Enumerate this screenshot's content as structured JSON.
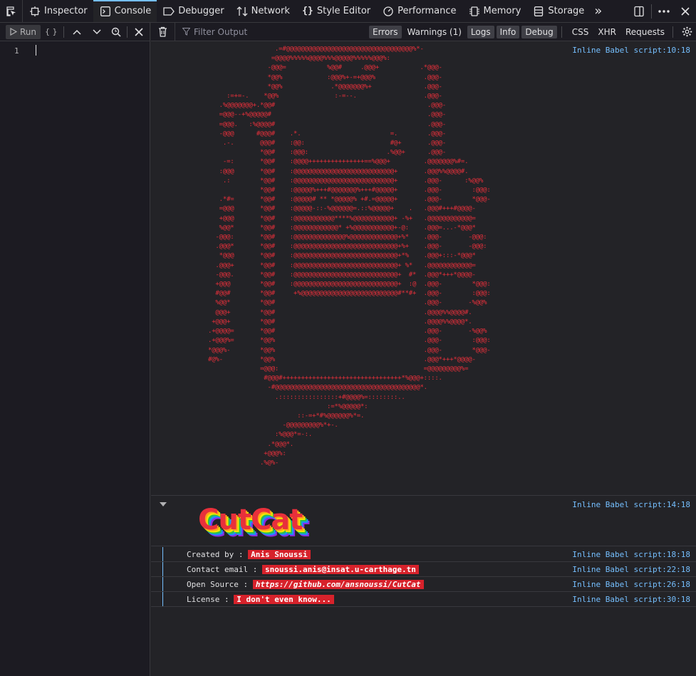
{
  "toolbar": {
    "tabs": [
      {
        "label": "Inspector",
        "icon": "inspector-icon"
      },
      {
        "label": "Console",
        "icon": "console-icon",
        "active": true
      },
      {
        "label": "Debugger",
        "icon": "debugger-icon"
      },
      {
        "label": "Network",
        "icon": "network-icon"
      },
      {
        "label": "Style Editor",
        "icon": "style-editor-icon"
      },
      {
        "label": "Performance",
        "icon": "performance-icon"
      },
      {
        "label": "Memory",
        "icon": "memory-icon"
      },
      {
        "label": "Storage",
        "icon": "storage-icon"
      }
    ],
    "overflow_label": "»"
  },
  "editor": {
    "run_label": "Run",
    "pretty_label": "{ }",
    "line_number": "1"
  },
  "filter": {
    "placeholder": "Filter Output",
    "buttons": {
      "errors": "Errors",
      "warnings": "Warnings (1)",
      "logs": "Logs",
      "info": "Info",
      "debug": "Debug",
      "css": "CSS",
      "xhr": "XHR",
      "requests": "Requests"
    }
  },
  "messages": {
    "art_location": "Inline Babel script:10:18",
    "ascii_art": "                  .=#@@@@@@@@@@@@@@@@@@@@@@@@@@@@@@@@@@%*-\n                 =@@@@%%%%%@@@@%%%@@@@@%%%%%@@@%:\n                -@@@=           %@@#     .@@@+           .*@@@-\n                *@@%            :@@@%+-=+@@@%             .@@@-\n                *@@%             .*@@@@@@@%+              .@@@-\n     :=+=-.    *@@%               :-=--.                  .@@@-\n   .%@@@@@@@+.*@@#                                         .@@@-\n   =@@@--+%@@@@@#                                          .@@@-\n   =@@@.   :%@@@@#                                         .@@@-\n   -@@@      #@@@#    .*.                        =.        .@@@-\n    .-.       @@@#    :@@:                       #@+       .@@@-\n              *@@#    :@@@:                     .%@@+      .@@@-\n    -=:       *@@#    :@@@@+++++++++++++++==%@@@+         .@@@@@@@%#=.\n   :@@@       *@@#    :@@@@@@@@@@@@@@@@@@@@@@@@@@@+       .@@@%%@@@@#.\n    .:        *@@#    :@@@@@@@@@@@@@@@@@@@@@@@@@@@+       .@@@-      :%@@%\n              *@@#    :@@@@@%+++#@@@@@@@%+++#@@@@@+       .@@@-        :@@@:\n   .*#=       *@@#    :@@@@@# ** *@@@@@% +#.=@@@@@+       .@@@-        *@@@-\n   =@@@       *@@#    :@@@@@-::-%@@@@@@=.::%@@@@@+    .   .@@@#+++#@@@@-\n   +@@@       *@@#    :@@@@@@@@@@@****%@@@@@@@@@@@+ -%+   .@@@@@@@@@@@@=\n   %@@*       *@@#    :@@@@@@@@@@@@* +%@@@@@@@@@@@+-@:    .@@@=...-*@@@*\n  -@@@:       *@@#    :@@@@@@@@@@@@@@%@@@@@@@@@@@@@+%*    .@@@-       -@@@:\n  .@@@*       *@@#    :@@@@@@@@@@@@@@@@@@@@@@@@@@@@+%+    .@@@-       -@@@:\n   *@@@       *@@#    :@@@@@@@@@@@@@@@@@@@@@@@@@@@@+*%    .@@@+:::-*@@@*\n  .@@@+       *@@#    :@@@@@@@@@@@@@@@@@@@@@@@@@@@@+ %*   .@@@@@@@@@@@@=\n  -@@@.       *@@#    :@@@@@@@@@@@@@@@@@@@@@@@@@@@@+  #*  .@@@*+++*@@@@-\n  +@@@        *@@#    :@@@@@@@@@@@@@@@@@@@@@@@@@@@@+  :@  .@@@-        *@@@:\n  #@@#        *@@#     +%@@@@@@@@@@@@@@@@@@@@@@@@@@#**#+  .@@@-        :@@@:\n  %@@*        *@@#                                        .@@@-       -%@@%\n  @@@+        *@@#                                        .@@@@%%@@@@#.\n +@@@+        *@@#                                        .@@@@%%@@@@*.\n.+@@@@=       *@@#                                        .@@@-       -%@@%\n.+@@@%=       *@@%                                        .@@@-        :@@@:\n*@@@%-        *@@%                                        .@@@-        *@@@-\n#@%-          *@@%                                        .@@@*+++*@@@@-\n              =@@@:                                       =@@@@@@@@@%=\n               #@@@#++++++++++++++++++++++++++++++++*%@@@+::::.\n                -#@@@@@@@@@@@@@@@@@@@@@@@@@@@@@@@@@@@@@@@*.\n                  .::::::::::::::::+#@@@@%=::::::::..\n                                :=*%@@@@@*:\n                        ::-=+*#%@@@@@@%*=.\n                    -@@@@@@@@@%*+-.\n                  :%@@@*=-:.\n                .*@@@*.\n               +@@@%:\n              .%@%-",
    "logo_location": "Inline Babel script:14:18",
    "logo_text": "CutCat",
    "rows": [
      {
        "label": "Created by : ",
        "value": "Anis Snoussi",
        "location": "Inline Babel script:18:18"
      },
      {
        "label": "Contact email : ",
        "value": "snoussi.anis@insat.u-carthage.tn",
        "location": "Inline Babel script:22:18"
      },
      {
        "label": "Open Source : ",
        "value": "https://github.com/ansnoussi/CutCat",
        "location": "Inline Babel script:26:18"
      },
      {
        "label": "License : ",
        "value": "I don't even know...",
        "location": "Inline Babel script:30:18"
      }
    ]
  },
  "colors": {
    "accent": "#75bfff",
    "error_red": "#e8303b",
    "badge_red": "#d7222b",
    "background": "#232327"
  }
}
